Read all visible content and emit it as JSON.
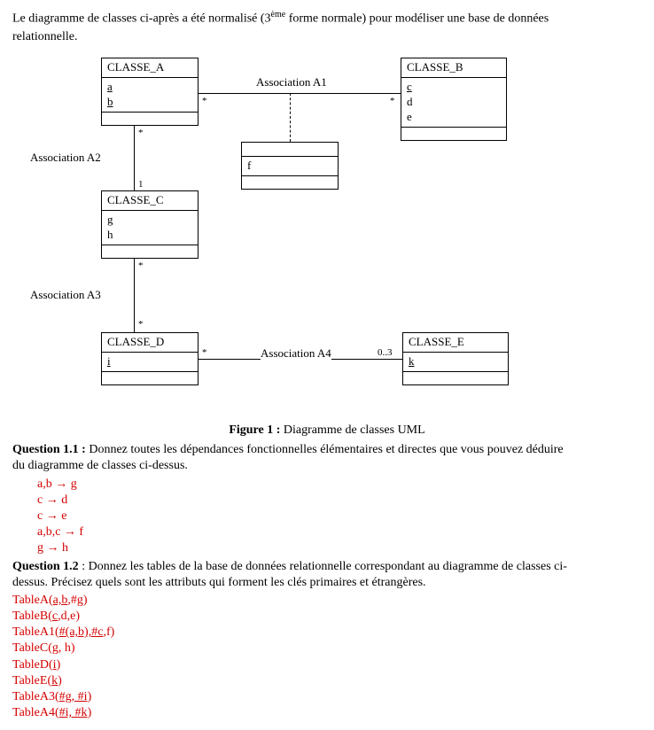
{
  "intro": {
    "line1_a": "Le diagramme de classes ci-après a été normalisé (3",
    "line1_sup": "ème",
    "line1_b": " forme normale) pour modéliser une base de données",
    "line2": "relationnelle."
  },
  "diagram": {
    "classA": {
      "name": "CLASSE_A",
      "attrs": [
        "a",
        "b"
      ]
    },
    "classB": {
      "name": "CLASSE_B",
      "attrs": [
        "c",
        "d",
        "e"
      ]
    },
    "classC": {
      "name": "CLASSE_C",
      "attrs": [
        "g",
        "h"
      ]
    },
    "classD": {
      "name": "CLASSE_D",
      "attrs": [
        "i"
      ]
    },
    "classE": {
      "name": "CLASSE_E",
      "attrs": [
        "k"
      ]
    },
    "assocF": {
      "attr": "f"
    },
    "labels": {
      "a1": "Association A1",
      "a2": "Association A2",
      "a3": "Association A3",
      "a4": "Association A4"
    },
    "mult": {
      "starA": "*",
      "starB": "*",
      "starC_top": "*",
      "one": "1",
      "starC_bot": "*",
      "starD_top": "*",
      "starD_right": "*",
      "zero3": "0..3"
    }
  },
  "figcap": {
    "bold": "Figure 1 :",
    "rest": " Diagramme de classes UML"
  },
  "q11": {
    "bold": "Question 1.1 :",
    "text": " Donnez toutes les dépendances fonctionnelles élémentaires et directes que vous pouvez déduire",
    "text2": "du diagramme de classes ci-dessus."
  },
  "ans11": [
    "a,b → g",
    "c → d",
    "c → e",
    "a,b,c → f",
    "g  → h"
  ],
  "q12": {
    "bold": "Question 1.2",
    "text": " : Donnez les tables de la base de données relationnelle correspondant au diagramme de classes ci-",
    "text2": "dessus. Précisez quels sont les attributs qui forment les clés primaires et étrangères."
  },
  "ans12": {
    "tA_pre": "TableA(",
    "tA_u": "a,b",
    "tA_post": ",#g)",
    "tB_pre": "TableB(",
    "tB_u": "c",
    "tB_post": ",d,e)",
    "tA1_pre": "TableA1(",
    "tA1_u": "#(a,b),#c",
    "tA1_post": ",f)",
    "tC_pre": "TableC(",
    "tC_u": "g",
    "tC_post": ", h)",
    "tD_pre": "TableD(",
    "tD_u": "i",
    "tD_post": ")",
    "tE_pre": "TableE(",
    "tE_u": "k",
    "tE_post": ")",
    "tA3_pre": "TableA3(",
    "tA3_u": "#g, #i",
    "tA3_post": ")",
    "tA4_pre": "TableA4(",
    "tA4_u": "#i, #k",
    "tA4_post": ")"
  }
}
